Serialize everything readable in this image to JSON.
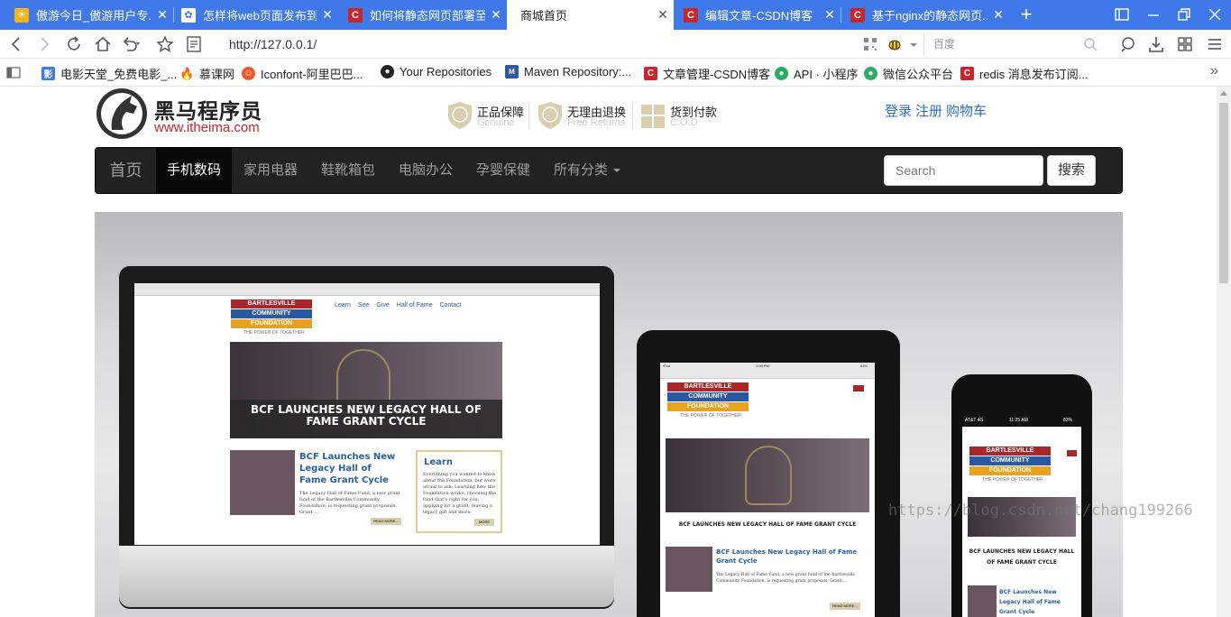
{
  "browser": {
    "tabs": [
      {
        "title": "傲游今日_傲游用户专...",
        "icon_color": "#f6b21a",
        "icon_glyph": "☀"
      },
      {
        "title": "怎样将web页面发布到...",
        "icon_color": "#ffffff",
        "icon_glyph": "✿"
      },
      {
        "title": "如何将静态网页部署至...",
        "icon_color": "#c9262b",
        "icon_glyph": "C"
      },
      {
        "title": "商城首页",
        "icon_color": "",
        "icon_glyph": ""
      },
      {
        "title": "编辑文章-CSDN博客",
        "icon_color": "#c9262b",
        "icon_glyph": "C"
      },
      {
        "title": "基于nginx的静态网页...",
        "icon_color": "#c9262b",
        "icon_glyph": "C"
      }
    ],
    "active_tab": 3,
    "close_glyph": "✕",
    "new_tab_glyph": "+",
    "address_url": "http://127.0.0.1/",
    "search_engine_placeholder": "百度",
    "bookmarks": [
      {
        "label": "电影天堂_免费电影_...",
        "icon_color": "#3d7be8",
        "icon_glyph": "影"
      },
      {
        "label": "慕课网",
        "icon_color": "#e5331b",
        "icon_glyph": "🔥"
      },
      {
        "label": "Iconfont-阿里巴巴...",
        "icon_color": "#f05a28",
        "icon_glyph": "☺"
      },
      {
        "label": "Your Repositories",
        "icon_color": "#222222",
        "icon_glyph": "●"
      },
      {
        "label": "Maven Repository:...",
        "icon_color": "#2c5aa0",
        "icon_glyph": "M"
      },
      {
        "label": "文章管理-CSDN博客",
        "icon_color": "#c9262b",
        "icon_glyph": "C"
      },
      {
        "label": "API · 小程序",
        "icon_color": "#2aae67",
        "icon_glyph": "●"
      },
      {
        "label": "微信公众平台",
        "icon_color": "#2aae67",
        "icon_glyph": "●"
      },
      {
        "label": "redis 消息发布订阅...",
        "icon_color": "#c9262b",
        "icon_glyph": "C"
      }
    ],
    "bookmarks_more": "»"
  },
  "site": {
    "logo_title": "黑马程序员",
    "logo_url": "www.itheima.com",
    "badges": [
      {
        "main": "正品保障",
        "sub": "Genuine",
        "glyph": "正"
      },
      {
        "main": "无理由退换",
        "sub": "Free Returns",
        "glyph": "退"
      },
      {
        "main": "货到付款",
        "sub": "C.O.D",
        "glyph": "⊕"
      }
    ],
    "top_links": [
      "登录",
      "注册",
      "购物车"
    ],
    "nav": {
      "brand": "首页",
      "items": [
        "手机数码",
        "家用电器",
        "鞋靴箱包",
        "电脑办公",
        "孕婴保健",
        "所有分类"
      ],
      "active_index": 0,
      "search_placeholder": "Search",
      "search_button": "搜索"
    },
    "carousel": {
      "prev_glyph": "‹",
      "foundation_line1": "BARTLESVILLE",
      "foundation_line2": "COMMUNITY",
      "foundation_line3": "FOUNDATION",
      "foundation_tagline": "THE POWER OF TOGETHER",
      "menu": [
        "Learn",
        "See",
        "Give",
        "Hall of Fame",
        "Contact"
      ],
      "headline": "BCF LAUNCHES NEW LEGACY HALL OF FAME GRANT CYCLE",
      "article_title": "BCF Launches New Legacy Hall of Fame Grant Cycle",
      "article_text": "The Legacy Hall of Fame Fund, a new grant fund of the Bartlesville Community Foundation, is requesting grant proposals. Grant ...",
      "continued": "Continued",
      "learn_title": "Learn",
      "learn_text": "Everything you wanted to know about the Foundation, but were afraid to ask: Learning how the Foundation works; choosing the fund that's right for you; applying for a grant; leaving a legacy gift and more.",
      "read_more": "READ MORE...",
      "more": "MORE",
      "phone_status_carrier": "AT&T 4G",
      "phone_status_time": "11:25 AM",
      "phone_status_batt": "83%",
      "tablet_status_device": "iPad",
      "tablet_status_time": "3:03 PM",
      "tablet_status_batt": "63%"
    },
    "watermark": "https://blog.csdn.net/chang199266"
  },
  "colors": {
    "tabbar": "#3f79e9",
    "nav_bg": "#222222",
    "link_blue": "#2a6fb8",
    "brand_red": "#c0282d"
  }
}
